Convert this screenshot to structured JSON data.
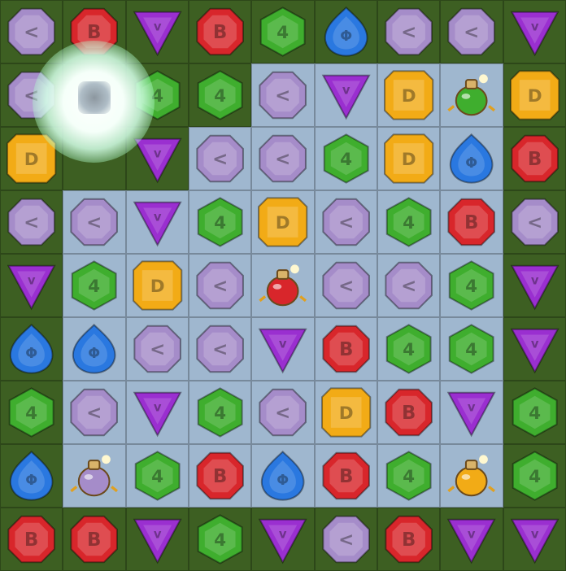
{
  "grid": {
    "rows": 9,
    "cols": 9,
    "gems": [
      [
        "purple-octagon",
        "red-octagon",
        "violet-triangle",
        "red-octagon",
        "green-hexagon",
        "blue-drop",
        "purple-octagon",
        "purple-octagon",
        "violet-triangle"
      ],
      [
        "purple-octagon",
        "empty",
        "green-hexagon",
        "green-hexagon",
        "purple-octagon",
        "violet-triangle",
        "yellow-square",
        "green-potion",
        "yellow-square"
      ],
      [
        "yellow-square",
        "empty",
        "violet-triangle",
        "purple-octagon",
        "purple-octagon",
        "green-hexagon",
        "yellow-square",
        "blue-drop",
        "red-octagon"
      ],
      [
        "purple-octagon",
        "purple-octagon",
        "violet-triangle",
        "green-hexagon",
        "yellow-square",
        "purple-octagon",
        "green-hexagon",
        "red-octagon",
        "purple-octagon"
      ],
      [
        "violet-triangle",
        "green-hexagon",
        "yellow-square",
        "purple-octagon",
        "red-potion",
        "purple-octagon",
        "purple-octagon",
        "green-hexagon",
        "violet-triangle"
      ],
      [
        "blue-drop",
        "blue-drop",
        "purple-octagon",
        "purple-octagon",
        "violet-triangle",
        "red-octagon",
        "green-hexagon",
        "green-hexagon",
        "violet-triangle"
      ],
      [
        "green-hexagon",
        "purple-octagon",
        "violet-triangle",
        "green-hexagon",
        "purple-octagon",
        "yellow-square",
        "red-octagon",
        "violet-triangle",
        "green-hexagon"
      ],
      [
        "blue-drop",
        "purple-potion",
        "green-hexagon",
        "red-octagon",
        "blue-drop",
        "red-octagon",
        "green-hexagon",
        "yellow-potion",
        "green-hexagon"
      ],
      [
        "red-octagon",
        "red-octagon",
        "violet-triangle",
        "green-hexagon",
        "violet-triangle",
        "purple-octagon",
        "red-octagon",
        "violet-triangle",
        "violet-triangle"
      ]
    ],
    "light_tiles": [
      [
        0,
        0,
        0,
        0,
        0,
        0,
        0,
        0,
        0
      ],
      [
        0,
        0,
        0,
        0,
        1,
        1,
        1,
        1,
        0
      ],
      [
        0,
        0,
        0,
        1,
        1,
        1,
        1,
        1,
        0
      ],
      [
        0,
        1,
        1,
        1,
        1,
        1,
        1,
        1,
        0
      ],
      [
        0,
        1,
        1,
        1,
        1,
        1,
        1,
        1,
        0
      ],
      [
        0,
        1,
        1,
        1,
        1,
        1,
        1,
        1,
        0
      ],
      [
        0,
        1,
        1,
        1,
        1,
        1,
        1,
        1,
        0
      ],
      [
        0,
        1,
        1,
        1,
        1,
        1,
        1,
        1,
        0
      ],
      [
        0,
        0,
        0,
        0,
        0,
        0,
        0,
        0,
        0
      ]
    ]
  },
  "colors": {
    "red": "#d8262b",
    "green": "#3fae2e",
    "blue": "#2a78e0",
    "purple": "#a58cc9",
    "violet": "#9a2fd0",
    "yellow": "#f2ab16",
    "tile_dark": "#3d5f22",
    "tile_light": "#9fb7cf"
  },
  "effects": {
    "explosion": "white-burst"
  }
}
